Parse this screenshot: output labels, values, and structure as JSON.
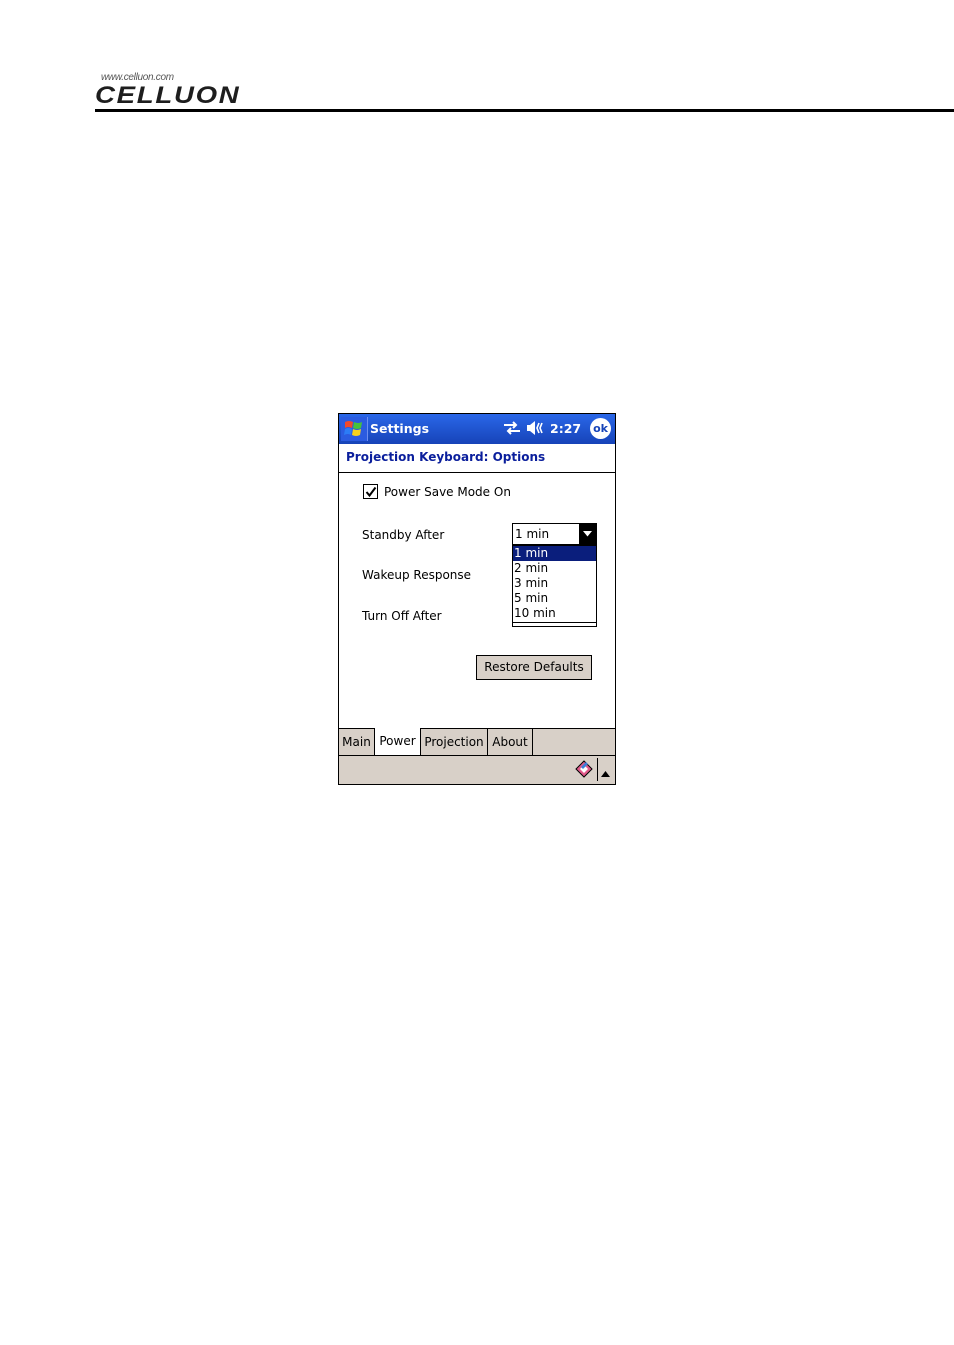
{
  "document": {
    "logo_url": "www.celluon.com",
    "logo_text": "CELLUON"
  },
  "titlebar": {
    "title": "Settings",
    "time": "2:27",
    "ok_label": "ok",
    "icons": [
      "windows-start-icon",
      "sync-icon",
      "speaker-icon"
    ]
  },
  "page": {
    "heading": "Projection Keyboard: Options"
  },
  "power": {
    "power_save_label": "Power Save Mode On",
    "power_save_checked": true,
    "standby_label": "Standby After",
    "wakeup_label": "Wakeup Response",
    "turnoff_label": "Turn Off After",
    "standby_value": "1 min",
    "standby_options": [
      "1 min",
      "2 min",
      "3 min",
      "5 min",
      "10 min"
    ],
    "standby_selected_index": 0,
    "restore_label": "Restore Defaults"
  },
  "tabs": [
    {
      "label": "Main",
      "active": false
    },
    {
      "label": "Power",
      "active": true
    },
    {
      "label": "Projection",
      "active": false
    },
    {
      "label": "About",
      "active": false
    }
  ],
  "colors": {
    "titlebar": "#1643b8",
    "heading": "#0a1e9c",
    "selection": "#0a1e7c",
    "chrome": "#d8d0c8"
  }
}
